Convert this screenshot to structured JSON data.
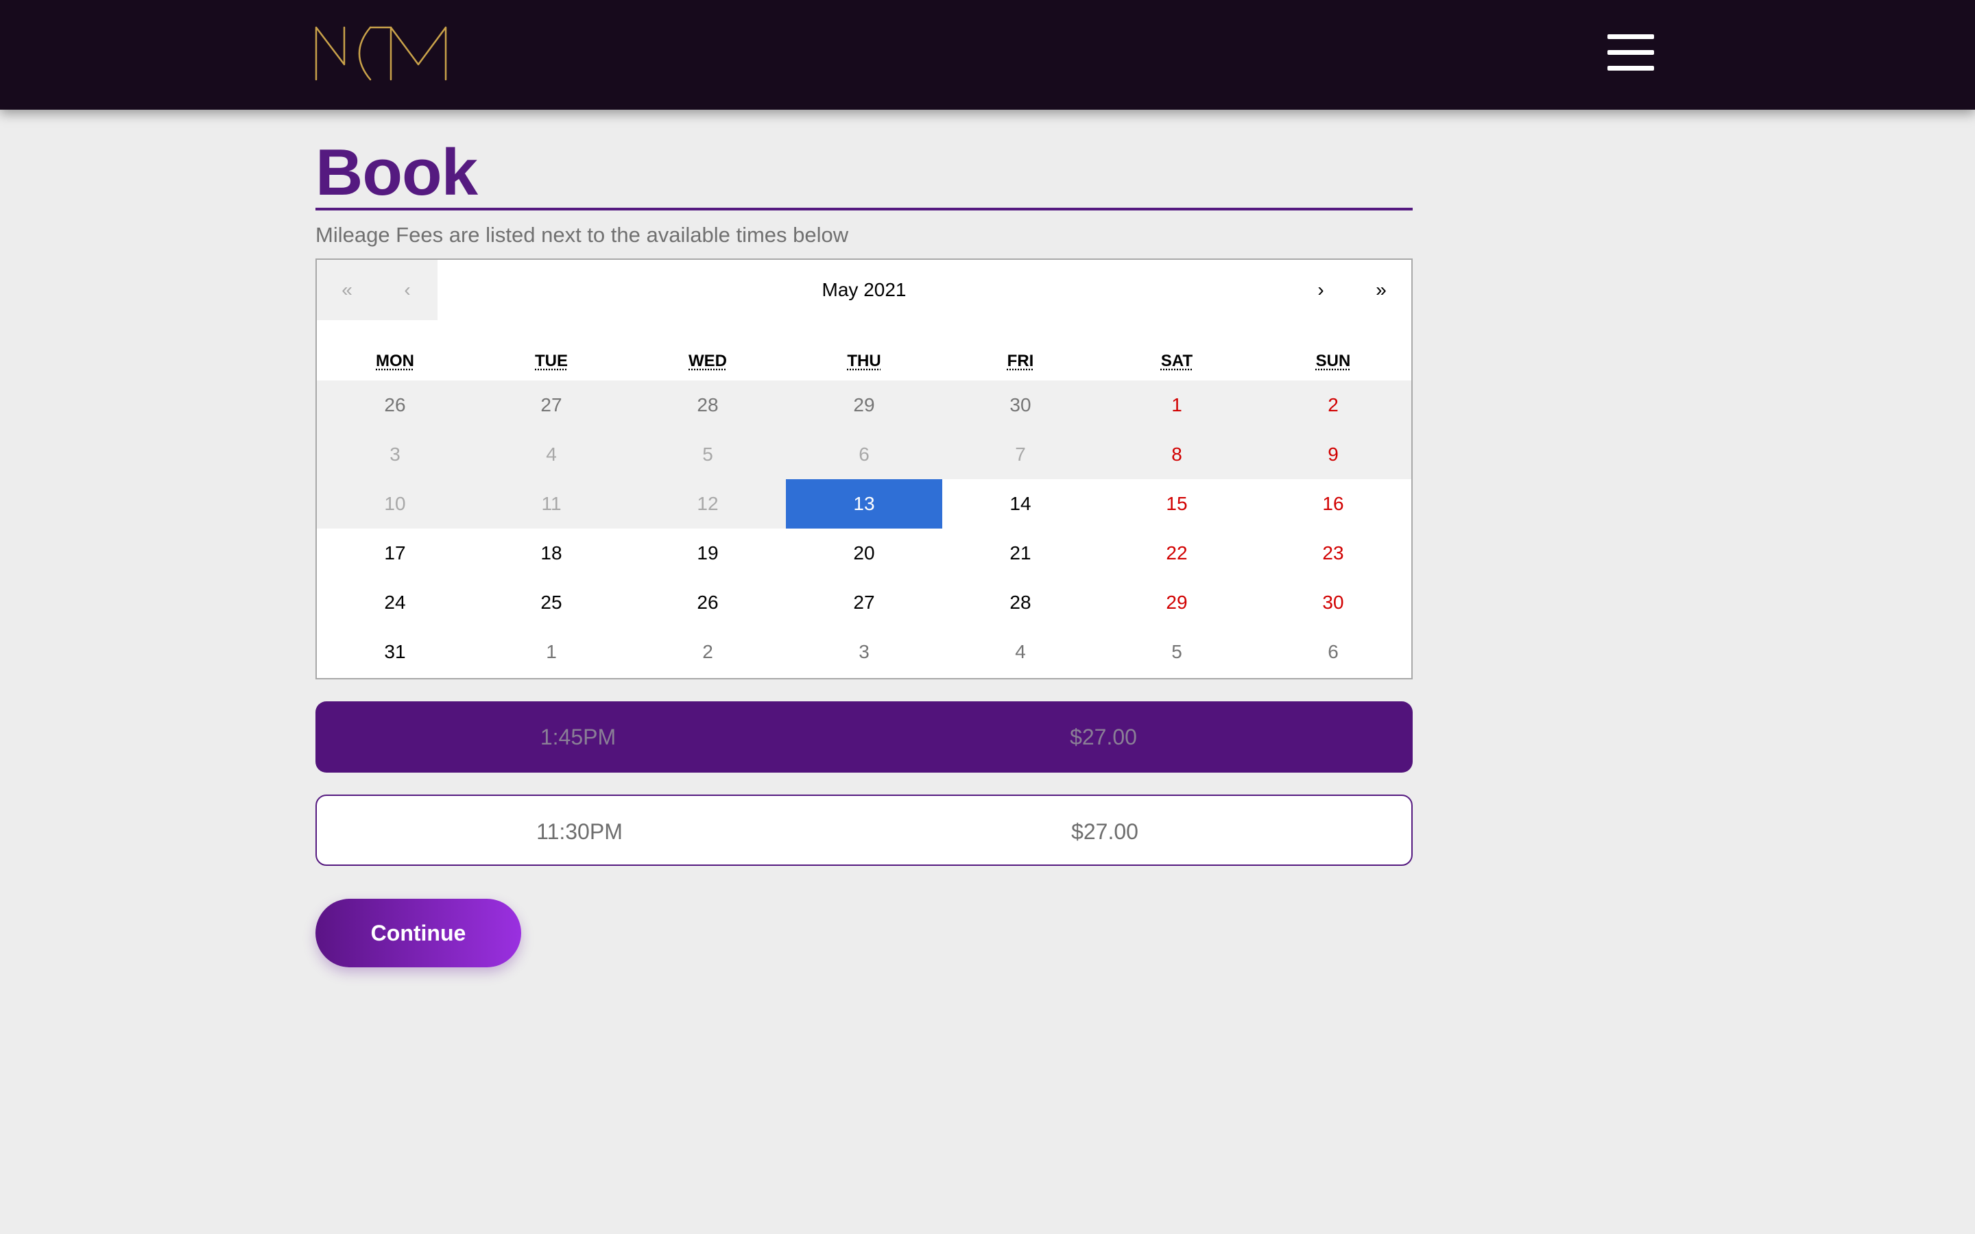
{
  "header": {
    "logo_text": "MCM",
    "logo_color": "#c9a24a",
    "menu_icon": "hamburger-menu-icon",
    "background": "#170a1c"
  },
  "page": {
    "title": "Book",
    "subtitle": "Mileage Fees are listed next to the available times below",
    "accent_color": "#551a80"
  },
  "calendar": {
    "prev_year_label": "«",
    "prev_month_label": "‹",
    "month_label": "May 2021",
    "next_month_label": "›",
    "next_year_label": "»",
    "weekdays": [
      "MON",
      "TUE",
      "WED",
      "THU",
      "FRI",
      "SAT",
      "SUN"
    ],
    "selected_color": "#2f6fd6",
    "weekend_color": "#d10000",
    "days": [
      {
        "label": "26",
        "neighbor": true,
        "weekend": false,
        "disabled": true,
        "selected": false
      },
      {
        "label": "27",
        "neighbor": true,
        "weekend": false,
        "disabled": true,
        "selected": false
      },
      {
        "label": "28",
        "neighbor": true,
        "weekend": false,
        "disabled": true,
        "selected": false
      },
      {
        "label": "29",
        "neighbor": true,
        "weekend": false,
        "disabled": true,
        "selected": false
      },
      {
        "label": "30",
        "neighbor": true,
        "weekend": false,
        "disabled": true,
        "selected": false
      },
      {
        "label": "1",
        "neighbor": false,
        "weekend": true,
        "disabled": true,
        "selected": false
      },
      {
        "label": "2",
        "neighbor": false,
        "weekend": true,
        "disabled": true,
        "selected": false
      },
      {
        "label": "3",
        "neighbor": false,
        "weekend": false,
        "disabled": true,
        "selected": false
      },
      {
        "label": "4",
        "neighbor": false,
        "weekend": false,
        "disabled": true,
        "selected": false
      },
      {
        "label": "5",
        "neighbor": false,
        "weekend": false,
        "disabled": true,
        "selected": false
      },
      {
        "label": "6",
        "neighbor": false,
        "weekend": false,
        "disabled": true,
        "selected": false
      },
      {
        "label": "7",
        "neighbor": false,
        "weekend": false,
        "disabled": true,
        "selected": false
      },
      {
        "label": "8",
        "neighbor": false,
        "weekend": true,
        "disabled": true,
        "selected": false
      },
      {
        "label": "9",
        "neighbor": false,
        "weekend": true,
        "disabled": true,
        "selected": false
      },
      {
        "label": "10",
        "neighbor": false,
        "weekend": false,
        "disabled": true,
        "selected": false
      },
      {
        "label": "11",
        "neighbor": false,
        "weekend": false,
        "disabled": true,
        "selected": false
      },
      {
        "label": "12",
        "neighbor": false,
        "weekend": false,
        "disabled": true,
        "selected": false
      },
      {
        "label": "13",
        "neighbor": false,
        "weekend": false,
        "disabled": false,
        "selected": true
      },
      {
        "label": "14",
        "neighbor": false,
        "weekend": false,
        "disabled": false,
        "selected": false
      },
      {
        "label": "15",
        "neighbor": false,
        "weekend": true,
        "disabled": false,
        "selected": false
      },
      {
        "label": "16",
        "neighbor": false,
        "weekend": true,
        "disabled": false,
        "selected": false
      },
      {
        "label": "17",
        "neighbor": false,
        "weekend": false,
        "disabled": false,
        "selected": false
      },
      {
        "label": "18",
        "neighbor": false,
        "weekend": false,
        "disabled": false,
        "selected": false
      },
      {
        "label": "19",
        "neighbor": false,
        "weekend": false,
        "disabled": false,
        "selected": false
      },
      {
        "label": "20",
        "neighbor": false,
        "weekend": false,
        "disabled": false,
        "selected": false
      },
      {
        "label": "21",
        "neighbor": false,
        "weekend": false,
        "disabled": false,
        "selected": false
      },
      {
        "label": "22",
        "neighbor": false,
        "weekend": true,
        "disabled": false,
        "selected": false
      },
      {
        "label": "23",
        "neighbor": false,
        "weekend": true,
        "disabled": false,
        "selected": false
      },
      {
        "label": "24",
        "neighbor": false,
        "weekend": false,
        "disabled": false,
        "selected": false
      },
      {
        "label": "25",
        "neighbor": false,
        "weekend": false,
        "disabled": false,
        "selected": false
      },
      {
        "label": "26",
        "neighbor": false,
        "weekend": false,
        "disabled": false,
        "selected": false
      },
      {
        "label": "27",
        "neighbor": false,
        "weekend": false,
        "disabled": false,
        "selected": false
      },
      {
        "label": "28",
        "neighbor": false,
        "weekend": false,
        "disabled": false,
        "selected": false
      },
      {
        "label": "29",
        "neighbor": false,
        "weekend": true,
        "disabled": false,
        "selected": false
      },
      {
        "label": "30",
        "neighbor": false,
        "weekend": true,
        "disabled": false,
        "selected": false
      },
      {
        "label": "31",
        "neighbor": false,
        "weekend": false,
        "disabled": false,
        "selected": false
      },
      {
        "label": "1",
        "neighbor": true,
        "weekend": false,
        "disabled": false,
        "selected": false
      },
      {
        "label": "2",
        "neighbor": true,
        "weekend": false,
        "disabled": false,
        "selected": false
      },
      {
        "label": "3",
        "neighbor": true,
        "weekend": false,
        "disabled": false,
        "selected": false
      },
      {
        "label": "4",
        "neighbor": true,
        "weekend": false,
        "disabled": false,
        "selected": false
      },
      {
        "label": "5",
        "neighbor": true,
        "weekend": false,
        "disabled": false,
        "selected": false
      },
      {
        "label": "6",
        "neighbor": true,
        "weekend": false,
        "disabled": false,
        "selected": false
      }
    ]
  },
  "time_slots": [
    {
      "time": "1:45PM",
      "fee": "$27.00",
      "selected": true
    },
    {
      "time": "11:30PM",
      "fee": "$27.00",
      "selected": false
    }
  ],
  "actions": {
    "continue_label": "Continue"
  }
}
